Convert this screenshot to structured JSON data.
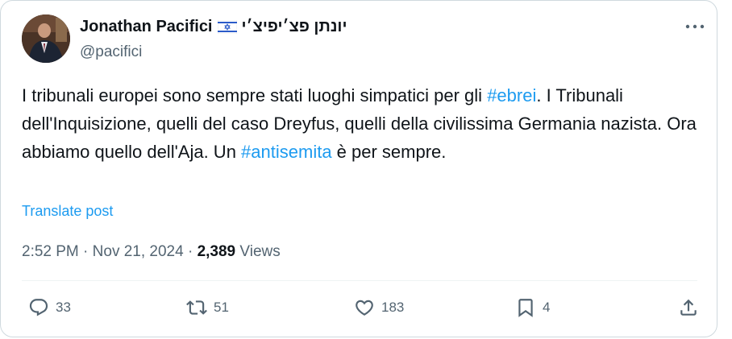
{
  "author": {
    "name": "Jonathan Pacifici",
    "name_hebrew": "יונתן פצ׳יפיצ׳י",
    "handle": "@pacifici",
    "flag_icon": "israel-flag-icon"
  },
  "post": {
    "text_segments": [
      {
        "text": "I tribunali europei sono sempre stati luoghi simpatici per gli ",
        "type": "text"
      },
      {
        "text": "#ebrei",
        "type": "hashtag"
      },
      {
        "text": ". I Tribunali dell'Inquisizione, quelli del caso Dreyfus, quelli della civilissima Germania nazista. Ora abbiamo quello dell'Aja. Un ",
        "type": "text"
      },
      {
        "text": "#antisemita",
        "type": "hashtag"
      },
      {
        "text": " è per sempre.",
        "type": "text"
      }
    ],
    "translate_label": "Translate post"
  },
  "meta": {
    "time": "2:52 PM",
    "sep1": " · ",
    "date": "Nov 21, 2024",
    "sep2": " · ",
    "views_count": "2,389",
    "views_label": " Views"
  },
  "actions": {
    "reply_count": "33",
    "repost_count": "51",
    "like_count": "183",
    "bookmark_count": "4"
  },
  "colors": {
    "accent": "#1d9bf0",
    "secondary_text": "#536471",
    "primary_text": "#0f1419",
    "border": "#cfd9de"
  }
}
